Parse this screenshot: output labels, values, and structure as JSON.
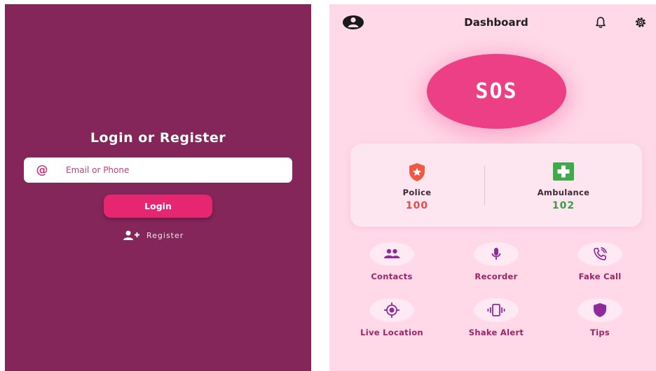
{
  "login": {
    "title": "Login or Register",
    "email_placeholder": "Email or Phone",
    "email_value": "",
    "login_label": "Login",
    "register_label": "Register"
  },
  "dashboard": {
    "title": "Dashboard",
    "sos_label": "SOS",
    "emergency": [
      {
        "label": "Police",
        "number": "100",
        "icon": "police-shield-icon",
        "color": "#e04b4b"
      },
      {
        "label": "Ambulance",
        "number": "102",
        "icon": "medical-cross-icon",
        "color": "#3e9c49"
      }
    ],
    "features": [
      {
        "label": "Contacts",
        "icon": "contacts-icon"
      },
      {
        "label": "Recorder",
        "icon": "microphone-icon"
      },
      {
        "label": "Fake Call",
        "icon": "phone-call-icon"
      },
      {
        "label": "Live Location",
        "icon": "location-target-icon"
      },
      {
        "label": "Shake Alert",
        "icon": "vibration-icon"
      },
      {
        "label": "Tips",
        "icon": "shield-icon"
      }
    ]
  },
  "colors": {
    "login_bg": "#84265a",
    "accent_pink": "#e62670",
    "dashboard_bg": "#ffd9e8",
    "sos_pink": "#ec3f86",
    "feature_purple": "#9b2367"
  }
}
